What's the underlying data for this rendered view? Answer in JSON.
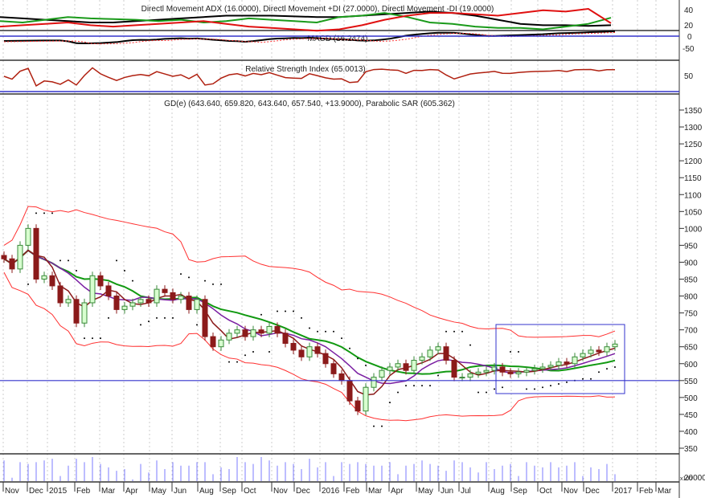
{
  "chart_data": {
    "type": "candlestick",
    "panels": {
      "dmi_title": "Directl Movement ADX (16.0000), Directl Movement +DI (27.0000), Directl Movement -DI (19.0000)",
      "macd_title": "MACD (16.2474)",
      "rsi_title": "Relative Strength Index (65.0013)",
      "price_title": "GD(e) (643.640, 659.820, 643.640, 657.540, +13.9000), Parabolic SAR (605.362)"
    },
    "dmi_ticks": [
      "40",
      "20"
    ],
    "macd_ticks": [
      "0",
      "-50"
    ],
    "rsi_ticks": [
      "50"
    ],
    "price_ticks": [
      "1350",
      "1300",
      "1250",
      "1200",
      "1150",
      "1100",
      "1050",
      "1000",
      "950",
      "900",
      "850",
      "800",
      "750",
      "700",
      "650",
      "600",
      "550",
      "500",
      "450",
      "400",
      "350"
    ],
    "volume_tick": "20000",
    "volume_unit": "x100",
    "x_labels": [
      "Nov",
      "Dec",
      "2015",
      "Feb",
      "Mar",
      "Apr",
      "May",
      "Jun",
      "Aug",
      "Sep",
      "Oct",
      "Nov",
      "Dec",
      "2016",
      "Feb",
      "Mar",
      "Apr",
      "May",
      "Jun",
      "Jul",
      "Aug",
      "Sep",
      "Oct",
      "Nov",
      "Dec",
      "2017",
      "Feb",
      "Mar"
    ],
    "ylim": [
      350,
      1370
    ],
    "horizontal_line": 550,
    "close": [
      910,
      880,
      950,
      1000,
      850,
      860,
      830,
      780,
      790,
      720,
      780,
      860,
      830,
      800,
      760,
      770,
      780,
      790,
      780,
      820,
      810,
      790,
      800,
      760,
      790,
      680,
      650,
      670,
      690,
      700,
      680,
      700,
      690,
      710,
      690,
      660,
      640,
      620,
      650,
      630,
      600,
      570,
      550,
      490,
      460,
      530,
      560,
      580,
      590,
      600,
      580,
      610,
      620,
      640,
      650,
      610,
      560,
      560,
      570,
      575,
      580,
      590,
      575,
      570,
      575,
      580,
      585,
      590,
      595,
      605,
      600,
      620,
      630,
      640,
      635,
      650,
      658
    ],
    "volume": [
      60,
      10,
      55,
      50,
      55,
      60,
      65,
      15,
      45,
      65,
      55,
      70,
      50,
      40,
      30,
      35,
      5,
      50,
      25,
      60,
      35,
      55,
      45,
      45,
      55,
      55,
      20,
      40,
      35,
      70,
      55,
      50,
      70,
      60,
      45,
      55,
      50,
      35,
      65,
      40,
      55,
      15,
      55,
      50,
      55,
      50,
      45,
      45,
      55,
      20,
      45,
      50,
      60,
      50,
      45,
      30,
      60,
      55,
      40,
      25,
      55,
      35,
      45,
      50,
      15,
      55,
      45,
      40,
      55,
      40,
      45,
      55,
      15,
      40,
      35,
      50,
      20
    ],
    "dmi": {
      "adx": [
        28,
        26,
        24,
        22,
        20,
        20,
        22,
        24,
        26,
        28,
        30,
        30,
        30,
        29,
        28,
        28,
        30,
        32,
        34,
        36,
        34,
        30,
        24,
        18,
        16,
        16,
        15,
        16
      ],
      "plus_di": [
        22,
        20,
        24,
        28,
        26,
        25,
        24,
        22,
        24,
        20,
        22,
        26,
        24,
        22,
        20,
        28,
        30,
        34,
        28,
        20,
        18,
        14,
        12,
        12,
        10,
        14,
        18,
        27
      ],
      "minus_di": [
        14,
        16,
        18,
        20,
        16,
        14,
        16,
        18,
        20,
        22,
        18,
        14,
        12,
        10,
        8,
        10,
        16,
        24,
        30,
        34,
        34,
        32,
        30,
        34,
        38,
        36,
        40,
        19
      ]
    },
    "colors": {
      "candle_up": "#d8ffd0",
      "candle_down": "#8b1a1a",
      "ma_fast": "#8b1a1a",
      "ma_mid": "#7a1fa2",
      "ma_slow": "#119911",
      "band": "#ff3030",
      "sar": "#000000",
      "volume": "#7b7bff",
      "hline": "#3333cc"
    }
  }
}
